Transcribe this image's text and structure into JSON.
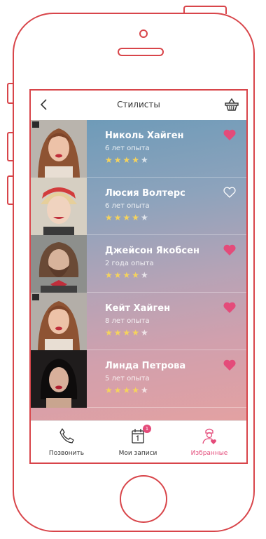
{
  "header": {
    "title": "Стилисты"
  },
  "stylists": [
    {
      "name": "Николь Хайген",
      "experience": "6 лет опыта",
      "rating": 4,
      "favorite": true
    },
    {
      "name": "Люсия Волтерс",
      "experience": "6 лет опыта",
      "rating": 4,
      "favorite": false
    },
    {
      "name": "Джейсон Якобсен",
      "experience": "2 года опыта",
      "rating": 4,
      "favorite": true
    },
    {
      "name": "Кейт Хайген",
      "experience": "8 лет опыта",
      "rating": 4,
      "favorite": true
    },
    {
      "name": "Линда Петрова",
      "experience": "5 лет опыта",
      "rating": 4,
      "favorite": true
    }
  ],
  "tabbar": {
    "call": "Позвонить",
    "appointments": "Мои записи",
    "appointments_badge": "1",
    "favorites": "Избранные"
  },
  "colors": {
    "accent": "#e44b7a",
    "outline": "#d8454a",
    "star": "#f5d35c"
  }
}
